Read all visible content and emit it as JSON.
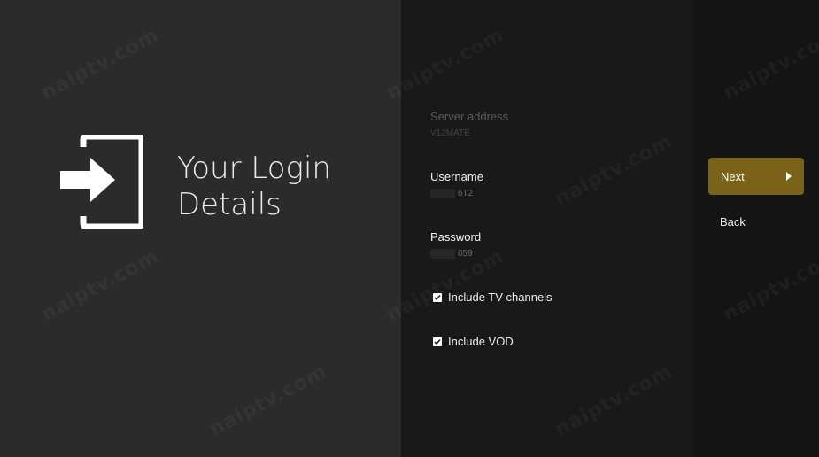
{
  "header": {
    "title": "Your Login Details",
    "icon": "login-icon"
  },
  "form": {
    "server": {
      "label": "Server address",
      "value": "V12MATE"
    },
    "username": {
      "label": "Username",
      "value": "6T2"
    },
    "password": {
      "label": "Password",
      "value": "059"
    },
    "checkboxes": [
      {
        "label": "Include TV channels",
        "checked": true
      },
      {
        "label": "Include VOD",
        "checked": true
      }
    ]
  },
  "actions": {
    "next_label": "Next",
    "back_label": "Back"
  },
  "watermark": "naiptv.com",
  "colors": {
    "accent": "#7a6318",
    "left_panel": "#2b2b2b",
    "middle_panel": "#191919",
    "right_panel": "#141414"
  }
}
